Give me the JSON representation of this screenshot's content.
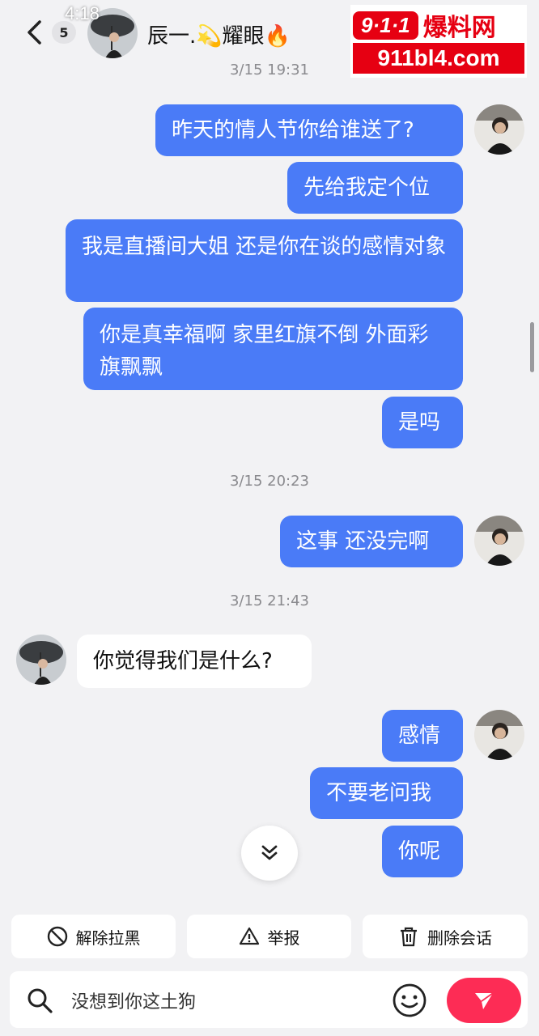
{
  "status": {
    "time": "4:18"
  },
  "header": {
    "unread_count": "5",
    "contact_name": "辰一.💫耀眼🔥"
  },
  "watermark": {
    "logo": "9·1·1",
    "name": "爆料网",
    "url": "911bl4.com"
  },
  "messages": [
    {
      "type": "timestamp",
      "text": "3/15 19:31"
    },
    {
      "type": "out",
      "text": "昨天的情人节你给谁送了?"
    },
    {
      "type": "out",
      "text": "先给我定个位"
    },
    {
      "type": "out",
      "text": "我是直播间大姐 还是你在谈的感情对象"
    },
    {
      "type": "out",
      "text": "你是真幸福啊 家里红旗不倒 外面彩旗飘飘"
    },
    {
      "type": "out",
      "text": "是吗"
    },
    {
      "type": "timestamp",
      "text": "3/15 20:23"
    },
    {
      "type": "out",
      "text": "这事 还没完啊"
    },
    {
      "type": "timestamp",
      "text": "3/15 21:43"
    },
    {
      "type": "in",
      "text": "你觉得我们是什么?"
    },
    {
      "type": "out",
      "text": "感情"
    },
    {
      "type": "out",
      "text": "不要老问我"
    },
    {
      "type": "out",
      "text": "你呢"
    }
  ],
  "actions": {
    "unblock": "解除拉黑",
    "report": "举报",
    "delete_chat": "删除会话"
  },
  "input": {
    "value": "没想到你这土狗"
  },
  "colors": {
    "outgoing_bubble": "#4a7bf7",
    "incoming_bubble": "#ffffff",
    "send_button": "#fd2c55",
    "background": "#f2f2f4"
  },
  "icons": [
    "back-icon",
    "more-icon",
    "chevron-double-down-icon",
    "ban-icon",
    "warning-icon",
    "trash-icon",
    "search-icon",
    "emoji-icon",
    "send-icon"
  ]
}
